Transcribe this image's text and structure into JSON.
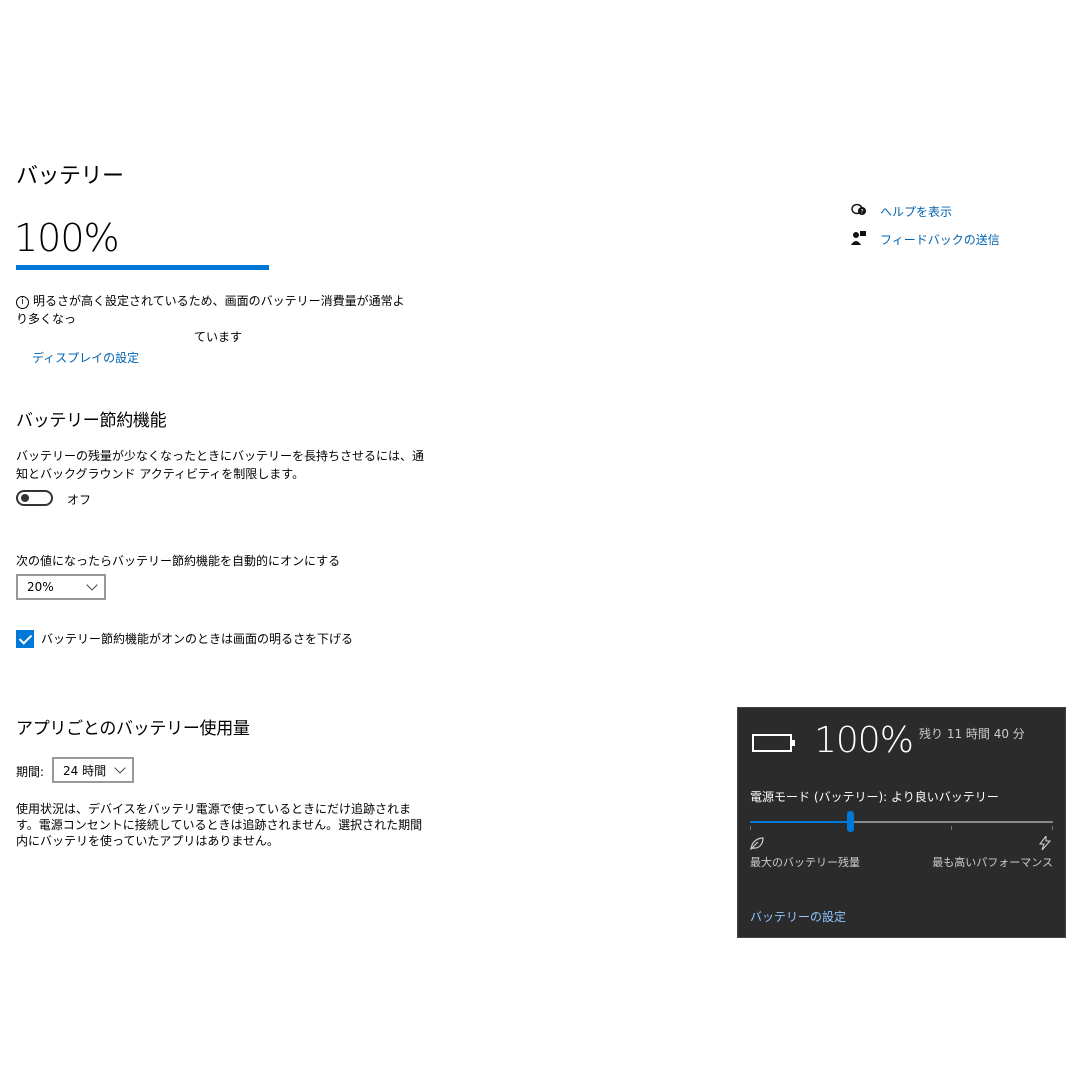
{
  "page": {
    "title": "バッテリー",
    "percent": "100%",
    "level": 1.0,
    "info_icon": "i",
    "info_text_line1": "明るさが高く設定されているため、画面のバッテリー消費量が通常より多くなっ",
    "info_text_line2": "ています",
    "display_link": "ディスプレイの設定"
  },
  "saver": {
    "heading": "バッテリー節約機能",
    "description": "バッテリーの残量が少なくなったときにバッテリーを長持ちさせるには、通知とバックグラウンド アクティビティを制限します。",
    "toggle_state": "オフ",
    "auto_label": "次の値になったらバッテリー節約機能を自動的にオンにする",
    "threshold": "20%",
    "checkbox_label": "バッテリー節約機能がオンのときは画面の明るさを下げる",
    "checkbox_checked": true
  },
  "apps": {
    "heading": "アプリごとのバッテリー使用量",
    "period_label": "期間:",
    "period_value": "24 時間",
    "description": "使用状況は、デバイスをバッテリ電源で使っているときにだけ追跡されます。電源コンセントに接続しているときは追跡されません。選択された期間内にバッテリを使っていたアプリはありません。"
  },
  "sidebar": {
    "help_icon": "help-icon",
    "help_label": "ヘルプを表示",
    "feedback_icon": "feedback-icon",
    "feedback_label": "フィードバックの送信"
  },
  "flyout": {
    "percent": "100%",
    "remaining": "残り 11 時間 40 分",
    "mode_label": "電源モード (バッテリー): より良いバッテリー",
    "slider_level": 0.33,
    "min_label": "最大のバッテリー残量",
    "max_label": "最も高いパフォーマンス",
    "settings_link": "バッテリーの設定"
  },
  "colors": {
    "accent": "#0078d7",
    "link": "#0063b1",
    "flyout_bg": "#2b2b2b"
  }
}
